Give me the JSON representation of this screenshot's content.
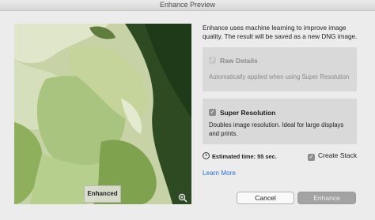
{
  "window": {
    "title": "Enhance Preview"
  },
  "preview": {
    "badge": "Enhanced",
    "zoom_icon": "zoom-in-icon"
  },
  "description": "Enhance uses machine learning to improve image quality. The result will be saved as a new DNG image.",
  "raw_details": {
    "title": "Raw Details",
    "checked": true,
    "disabled": true,
    "text": "Automatically applied when using Super Resolution"
  },
  "super_resolution": {
    "title": "Super Resolution",
    "checked": true,
    "text": "Doubles image resolution. Ideal for large displays and prints."
  },
  "estimate": {
    "label": "Estimated time: 55 sec.",
    "icon": "clock-icon"
  },
  "create_stack": {
    "label": "Create Stack",
    "checked": true
  },
  "learn_more": "Learn More",
  "buttons": {
    "cancel": "Cancel",
    "enhance": "Enhance"
  },
  "colors": {
    "link": "#2a6fd6",
    "panel": "#d9d9d9",
    "primary_disabled": "#a3a3a3"
  }
}
